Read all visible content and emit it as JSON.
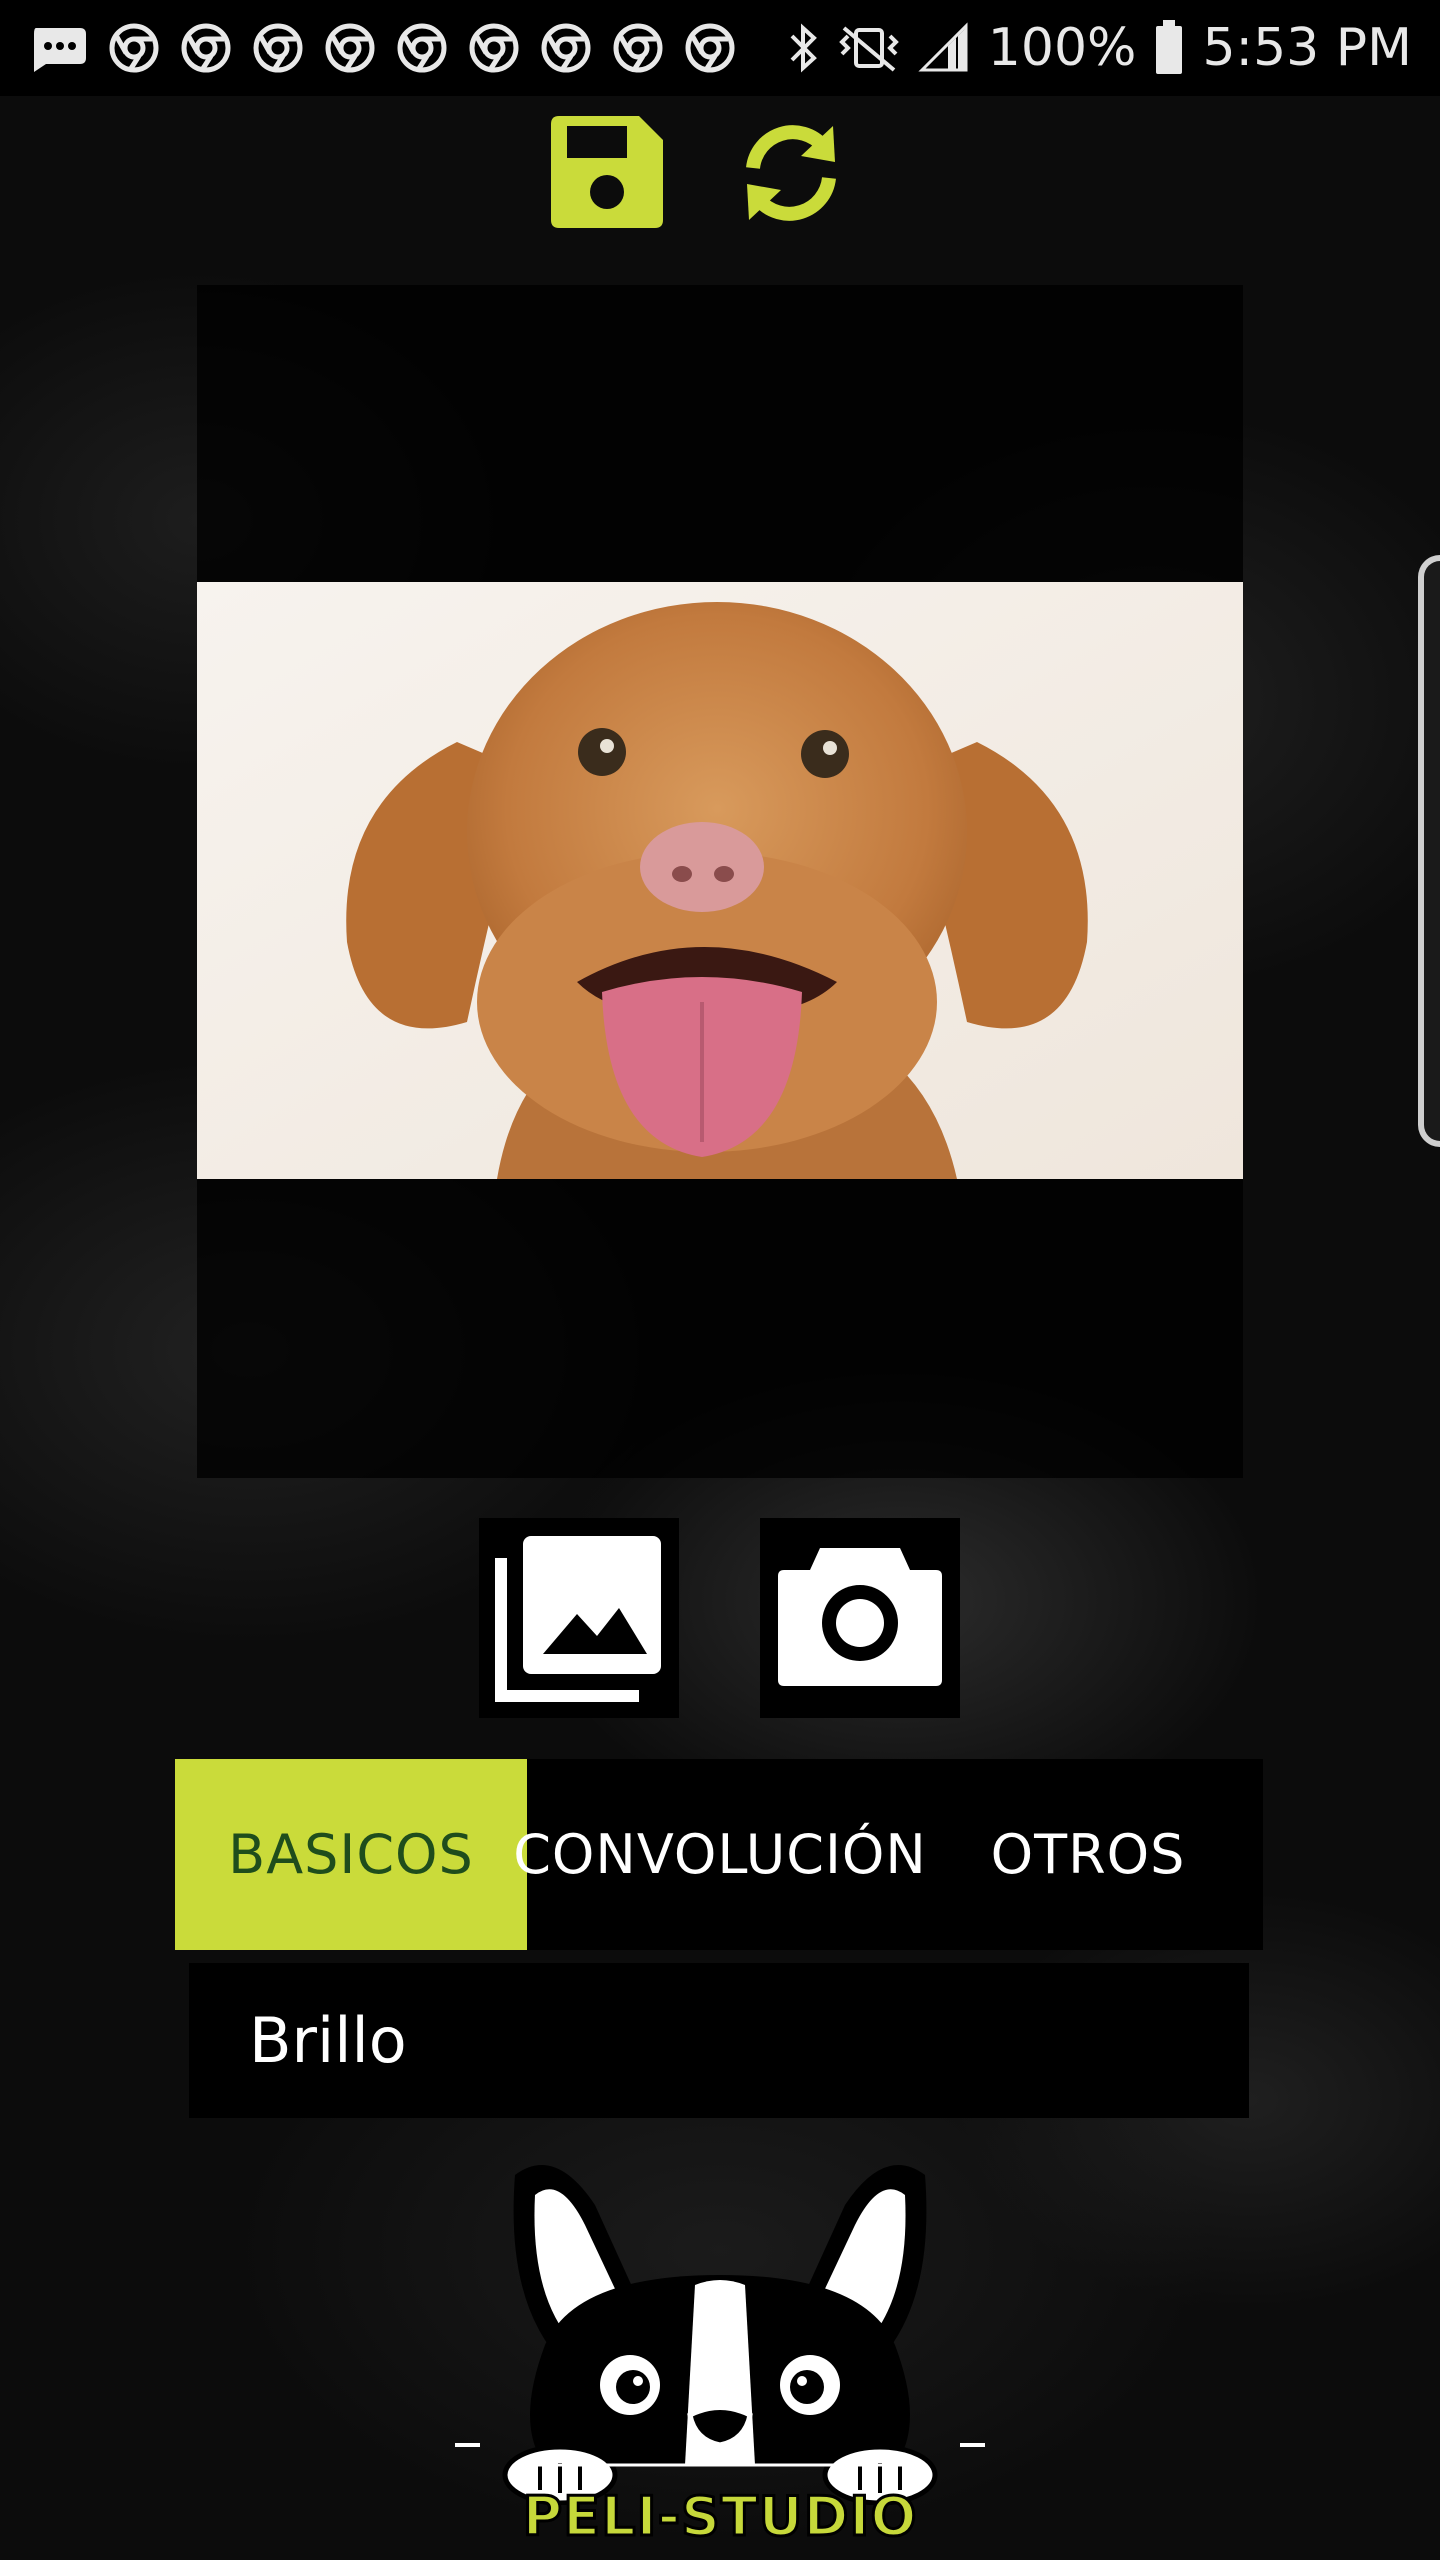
{
  "status_bar": {
    "battery": "100%",
    "time": "5:53 PM",
    "notification_icons": [
      "messages-icon",
      "chrome-icon",
      "chrome-icon",
      "chrome-icon",
      "chrome-icon",
      "chrome-icon",
      "chrome-icon",
      "chrome-icon",
      "chrome-icon",
      "chrome-icon"
    ],
    "system_icons": [
      "bluetooth-icon",
      "vibrate-icon",
      "signal-icon",
      "battery-icon"
    ]
  },
  "toolbar": {
    "save_icon": "save-icon",
    "refresh_icon": "refresh-icon",
    "accent_color": "#cadb3a"
  },
  "image_panel": {
    "photo": "dog-photo"
  },
  "source_buttons": {
    "gallery_icon": "gallery-icon",
    "camera_icon": "camera-icon"
  },
  "tabs": {
    "items": [
      {
        "label": "BASICOS",
        "active": true
      },
      {
        "label": "CONVOLUCIÓN",
        "active": false
      },
      {
        "label": "OTROS",
        "active": false
      }
    ],
    "active_bg": "#cadb3a",
    "active_text": "#1f4d1c"
  },
  "filter": {
    "selected": "Brillo"
  },
  "logo": {
    "text": "PELI-STUDIO"
  }
}
